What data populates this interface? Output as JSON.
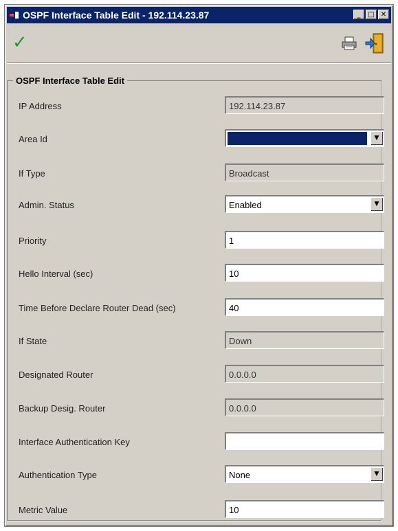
{
  "window": {
    "title": "OSPF Interface Table Edit - 192.114.23.87"
  },
  "title_buttons": {
    "minimize": "_",
    "maximize": "□",
    "close": "✕"
  },
  "toolbar": {
    "apply_icon": "check-icon",
    "print_icon": "print-icon",
    "exit_icon": "exit-icon"
  },
  "group": {
    "legend": "OSPF Interface Table Edit"
  },
  "fields": {
    "ip_address": {
      "label": "IP Address",
      "value": "192.114.23.87"
    },
    "area_id": {
      "label": "Area Id",
      "value": ""
    },
    "if_type": {
      "label": "If Type",
      "value": "Broadcast"
    },
    "admin_status": {
      "label": "Admin. Status",
      "value": "Enabled"
    },
    "priority": {
      "label": "Priority",
      "value": "1"
    },
    "hello_interval": {
      "label": "Hello Interval (sec)",
      "value": "10"
    },
    "router_dead": {
      "label": "Time Before Declare Router Dead (sec)",
      "value": "40"
    },
    "if_state": {
      "label": "If State",
      "value": "Down"
    },
    "designated_router": {
      "label": "Designated Router",
      "value": "0.0.0.0"
    },
    "backup_router": {
      "label": "Backup Desig. Router",
      "value": "0.0.0.0"
    },
    "auth_key": {
      "label": "Interface Authentication Key",
      "value": ""
    },
    "auth_type": {
      "label": "Authentication Type",
      "value": "None"
    },
    "metric": {
      "label": "Metric Value",
      "value": "10"
    }
  }
}
